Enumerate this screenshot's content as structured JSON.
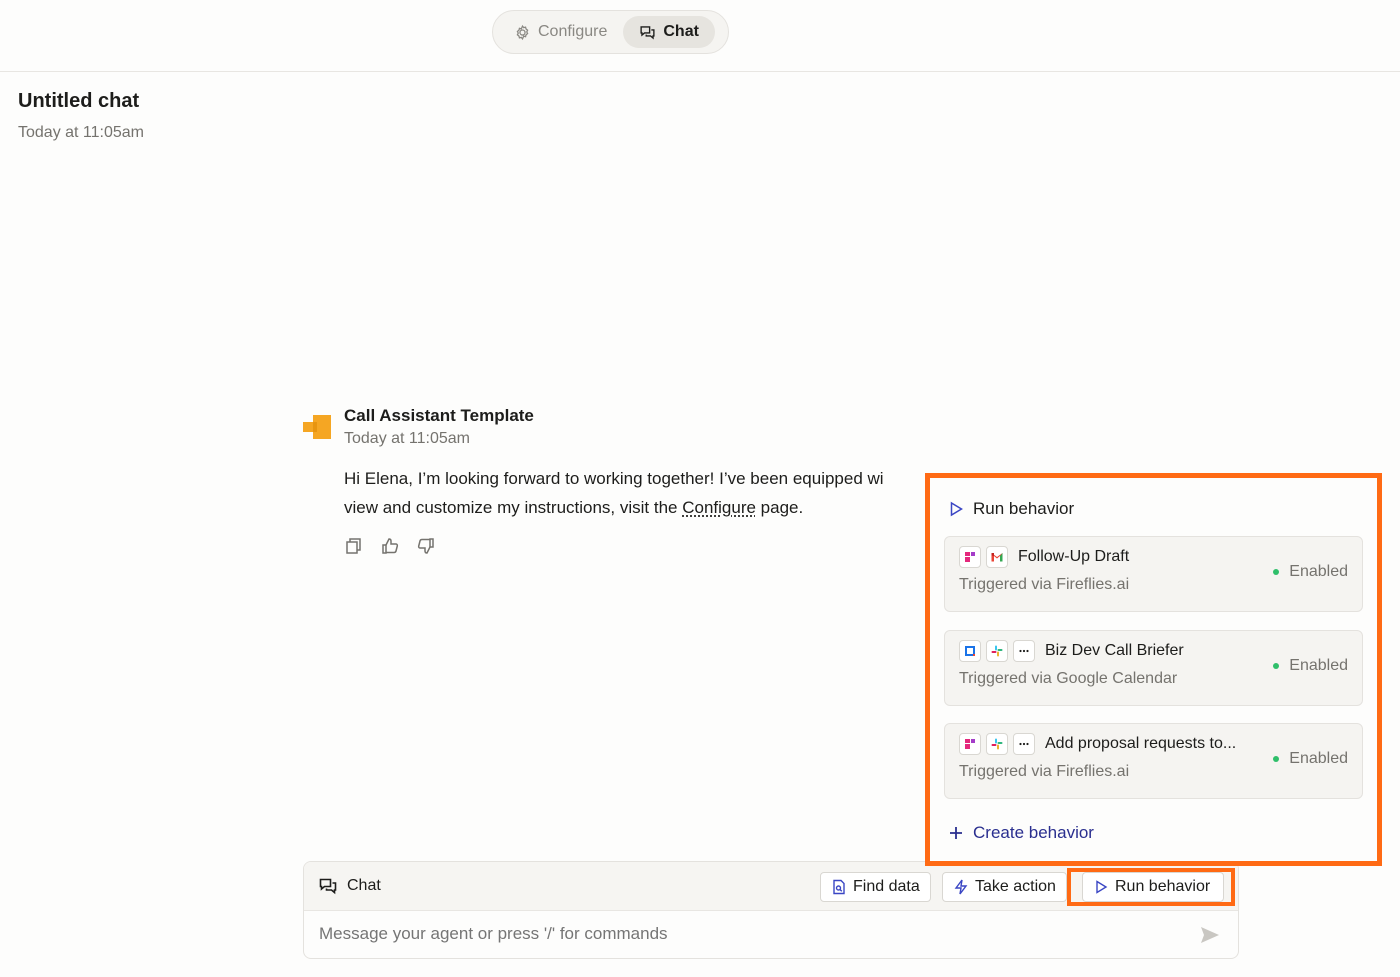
{
  "header": {
    "tabs": [
      {
        "label": "Configure",
        "icon": "gear-icon",
        "active": false
      },
      {
        "label": "Chat",
        "icon": "chat-bubbles-icon",
        "active": true
      }
    ]
  },
  "chat": {
    "title": "Untitled chat",
    "timestamp": "Today at 11:05am"
  },
  "message": {
    "author": "Call Assistant Template",
    "timestamp": "Today at 11:05am",
    "text_part1": "Hi Elena, I’m looking forward to working together! I’ve been equipped wi",
    "text_part2": "view and customize my instructions, visit the ",
    "link_text": "Configure",
    "text_part3": " page.",
    "actions": [
      "copy-icon",
      "thumbs-up-icon",
      "thumbs-down-icon"
    ]
  },
  "composer": {
    "label": "Chat",
    "buttons": {
      "find_data": "Find data",
      "take_action": "Take action",
      "run_behavior": "Run behavior"
    },
    "placeholder": "Message your agent or press '/' for commands"
  },
  "popup": {
    "title": "Run behavior",
    "behaviors": [
      {
        "name": "Follow-Up Draft",
        "trigger": "Triggered via Fireflies.ai",
        "status": "Enabled",
        "icons": [
          "fireflies-icon",
          "gmail-icon"
        ]
      },
      {
        "name": "Biz Dev Call Briefer",
        "trigger": "Triggered via Google Calendar",
        "status": "Enabled",
        "icons": [
          "google-calendar-icon",
          "slack-icon",
          "more-icon"
        ]
      },
      {
        "name": "Add proposal requests to...",
        "trigger": "Triggered via Fireflies.ai",
        "status": "Enabled",
        "icons": [
          "fireflies-icon",
          "slack-icon",
          "more-icon"
        ]
      }
    ],
    "create_label": "Create behavior"
  },
  "colors": {
    "highlight": "#ff6a14",
    "accent": "#2a2f8f",
    "enabled": "#2fbf6a",
    "agent_avatar": "#f5a623"
  }
}
